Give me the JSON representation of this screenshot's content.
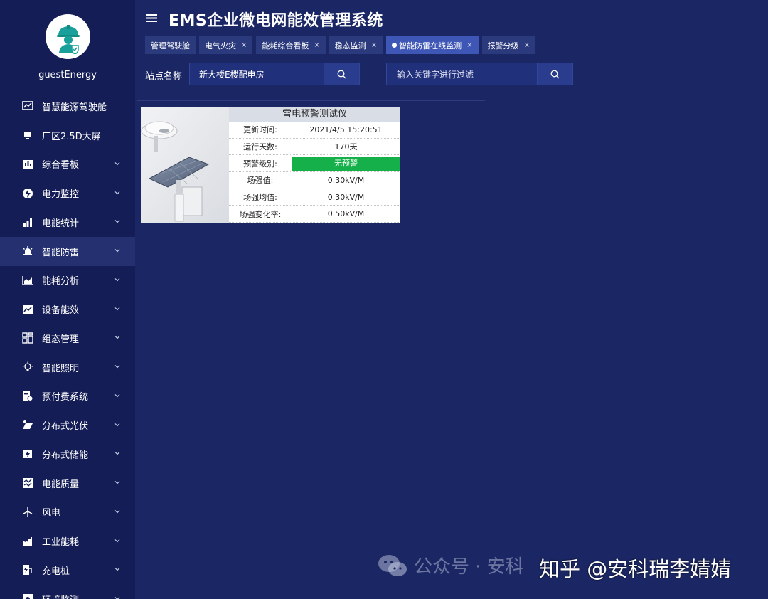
{
  "app": {
    "title": "EMS企业微电网能效管理系统"
  },
  "user": {
    "name": "guestEnergy"
  },
  "sidebar": {
    "items": [
      {
        "label": "智慧能源驾驶舱",
        "icon": "dashboard-icon",
        "chevron": false
      },
      {
        "label": "厂区2.5D大屏",
        "icon": "monitor-icon",
        "chevron": false
      },
      {
        "label": "综合看板",
        "icon": "board-icon",
        "chevron": true
      },
      {
        "label": "电力监控",
        "icon": "power-monitor-icon",
        "chevron": true
      },
      {
        "label": "电能统计",
        "icon": "bar-stats-icon",
        "chevron": true
      },
      {
        "label": "智能防雷",
        "icon": "alarm-light-icon",
        "chevron": true,
        "active": true
      },
      {
        "label": "能耗分析",
        "icon": "area-chart-icon",
        "chevron": true
      },
      {
        "label": "设备能效",
        "icon": "trend-icon",
        "chevron": true
      },
      {
        "label": "组态管理",
        "icon": "layout-icon",
        "chevron": true
      },
      {
        "label": "智能照明",
        "icon": "bulb-icon",
        "chevron": true
      },
      {
        "label": "预付费系统",
        "icon": "prepay-icon",
        "chevron": true
      },
      {
        "label": "分布式光伏",
        "icon": "solar-icon",
        "chevron": true
      },
      {
        "label": "分布式储能",
        "icon": "battery-icon",
        "chevron": true
      },
      {
        "label": "电能质量",
        "icon": "quality-icon",
        "chevron": true
      },
      {
        "label": "风电",
        "icon": "wind-icon",
        "chevron": true
      },
      {
        "label": "工业能耗",
        "icon": "factory-icon",
        "chevron": true
      },
      {
        "label": "充电桩",
        "icon": "charger-icon",
        "chevron": true
      },
      {
        "label": "环境监测",
        "icon": "environment-icon",
        "chevron": true
      }
    ]
  },
  "tabs": [
    {
      "label": "管理驾驶舱",
      "closable": false,
      "active": false
    },
    {
      "label": "电气火灾",
      "closable": true,
      "active": false
    },
    {
      "label": "能耗综合看板",
      "closable": true,
      "active": false
    },
    {
      "label": "稳态监测",
      "closable": true,
      "active": false
    },
    {
      "label": "智能防雷在线监测",
      "closable": true,
      "active": true
    },
    {
      "label": "报警分级",
      "closable": true,
      "active": false
    }
  ],
  "tab_close_glyph": "×",
  "filter": {
    "site_label": "站点名称",
    "site_value": "新大楼E楼配电房",
    "keyword_placeholder": "输入关键字进行过滤"
  },
  "device": {
    "title": "雷电预警测试仪",
    "rows": [
      {
        "key": "更新时间:",
        "value": "2021/4/5   15:20:51",
        "status": false
      },
      {
        "key": "运行天数:",
        "value": "170天",
        "status": false
      },
      {
        "key": "预警级别:",
        "value": "无预警",
        "status": true
      },
      {
        "key": "场强值:",
        "value": "0.30kV/M",
        "status": false
      },
      {
        "key": "场强均值:",
        "value": "0.30kV/M",
        "status": false
      },
      {
        "key": "场强变化率:",
        "value": "0.50kV/M",
        "status": false
      }
    ],
    "status_color": "#16b04a"
  },
  "watermark": {
    "left_text": "公众号 · 安科",
    "right_text": "知乎 @安科瑞李婧婧"
  },
  "colors": {
    "sidebar": "#141d55",
    "main": "#1b2765",
    "active_tab": "#3e56b5",
    "status_ok": "#16b04a"
  }
}
